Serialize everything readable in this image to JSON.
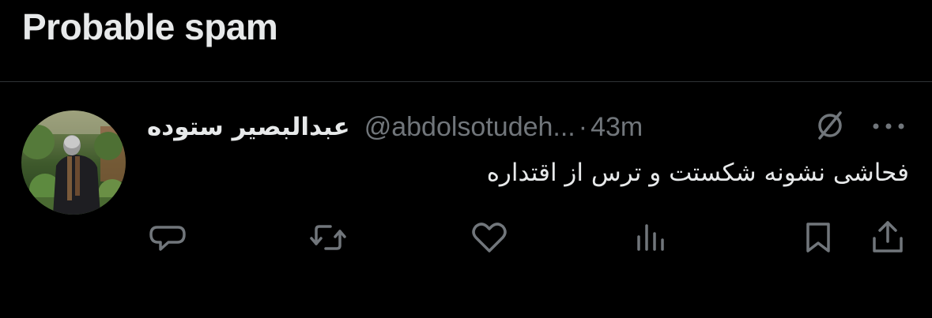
{
  "section": {
    "title": "Probable spam"
  },
  "tweet": {
    "author_name": "عبدالبصیر ستوده",
    "handle": "@abdolsotudeh...",
    "separator": "·",
    "time": "43m",
    "text": "فحاشی نشونه شکستت و ترس از اقتداره"
  },
  "icons": {
    "avatar": "profile-photo",
    "grok": "grok-icon",
    "more": "ellipsis-icon",
    "reply": "reply-icon",
    "repost": "repost-icon",
    "like": "heart-icon",
    "views": "analytics-icon",
    "bookmark": "bookmark-icon",
    "share": "share-icon"
  },
  "colors": {
    "background": "#000000",
    "primary_text": "#e7e9ea",
    "secondary_text": "#71767b",
    "divider": "#2f3336"
  }
}
